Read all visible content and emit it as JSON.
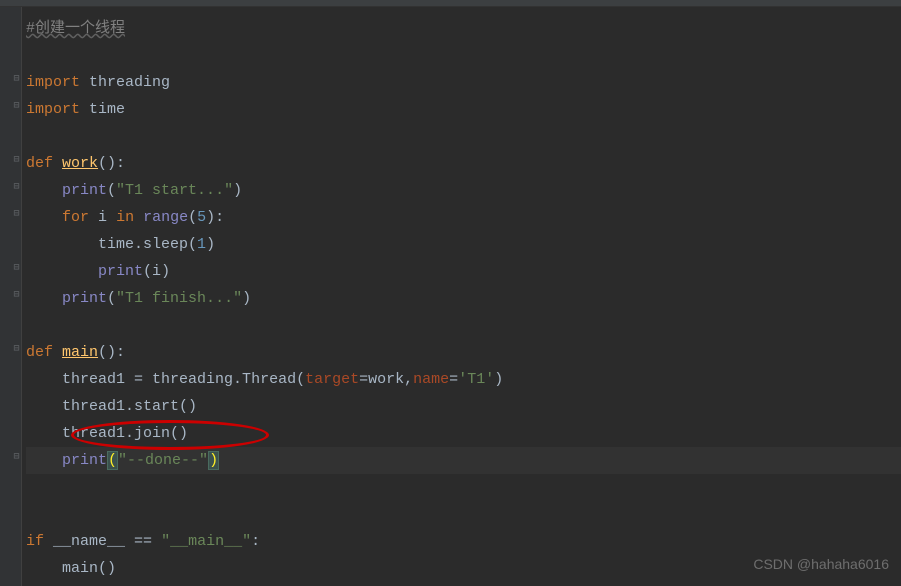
{
  "comment": "#创建一个线程",
  "imports": {
    "kw": "import",
    "threading": "threading",
    "time": "time"
  },
  "kw": {
    "def": "def",
    "for": "for",
    "in": "in",
    "if": "if"
  },
  "funcs": {
    "work": "work",
    "main": "main"
  },
  "builtins": {
    "print": "print",
    "range": "range"
  },
  "strings": {
    "t1start": "\"T1 start...\"",
    "t1finish": "\"T1 finish...\"",
    "t1name": "'T1'",
    "done": "\"--done--\"",
    "main": "\"__main__\""
  },
  "numbers": {
    "five": "5",
    "one": "1"
  },
  "params": {
    "target": "target",
    "name": "name"
  },
  "idents": {
    "i": "i",
    "time_sleep": "time.sleep",
    "thread1": "thread1",
    "threading_thread": "threading.Thread",
    "work_ref": "work",
    "start": ".start()",
    "join": ".join()",
    "name_dunder": "__name__",
    "main_call": "main"
  },
  "punct": {
    "colon": ":",
    "op_assign": " = ",
    "eq": "=",
    "comma": ",",
    "eqeq": " == ",
    "lparen": "(",
    "rparen": ")",
    "lparen_rparen_colon": "():",
    "lparen_rparen": "()"
  },
  "watermark": "CSDN @hahaha6016"
}
